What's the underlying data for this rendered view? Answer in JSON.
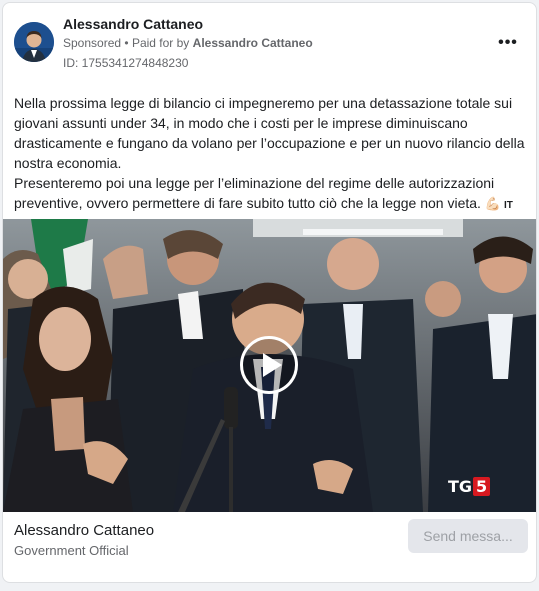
{
  "ad": {
    "page_name": "Alessandro Cattaneo",
    "sponsored_label": "Sponsored",
    "separator": "•",
    "paid_for_prefix": "Paid for by",
    "paid_for_by": "Alessandro Cattaneo",
    "ad_id": "ID: 1755341274848230",
    "more_icon": "more-options-icon"
  },
  "body": {
    "paragraph_1": "Nella prossima legge di bilancio ci impegneremo per una detassazione totale sui giovani assunti under 34, in modo che i costi per le imprese diminuiscano drasticamente e fungano da volano per l’occupazione e per un nuovo rilancio della nostra economia.",
    "paragraph_2": "Presenteremo poi una legge per l’eliminazione del regime delle autorizzazioni preventive, ovvero permettere di fare subito tutto ciò che la legge non vieta.",
    "emoji": "💪🏻",
    "lang_flag": "IT"
  },
  "media": {
    "type": "video",
    "play_icon": "play-icon",
    "watermark_prefix": "TG",
    "watermark_number": "5"
  },
  "footer": {
    "name": "Alessandro Cattaneo",
    "category": "Government Official",
    "cta_label": "Send messa..."
  },
  "colors": {
    "text_primary": "#1c1e21",
    "text_secondary": "#65676b",
    "button_bg": "#e4e6eb",
    "button_text": "#9ea1a6",
    "tg5_red": "#d71920"
  }
}
